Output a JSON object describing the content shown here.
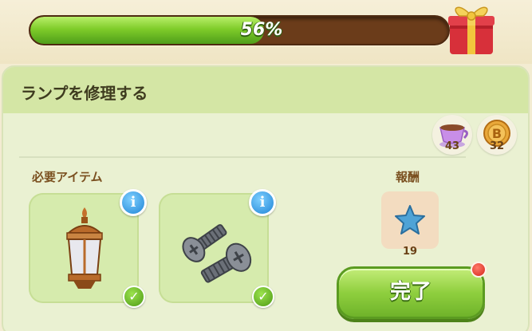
{
  "header": {
    "title_fragment": "",
    "progress_percent": 56,
    "progress_label": "56%"
  },
  "panel": {
    "title": "ランプを修理する",
    "resources": [
      {
        "icon": "teacup-icon",
        "count": "43"
      },
      {
        "icon": "coin-icon",
        "count": "32"
      }
    ],
    "required_label": "必要アイテム",
    "items": [
      {
        "icon": "lantern-icon",
        "info": "i",
        "check": "✓"
      },
      {
        "icon": "screws-icon",
        "info": "i",
        "check": "✓"
      }
    ],
    "reward_label": "報酬",
    "reward": {
      "icon": "blue-star-icon",
      "count": "19"
    },
    "done_label": "完了"
  },
  "colors": {
    "progress_fill": "#7fcc2a",
    "progress_track": "#6b3c1a",
    "panel_bg": "#eaf1d2",
    "panel_header": "#d4e6a5",
    "info_blue": "#1f84d6",
    "check_green": "#4d9a15",
    "notification_red": "#d4251a"
  }
}
